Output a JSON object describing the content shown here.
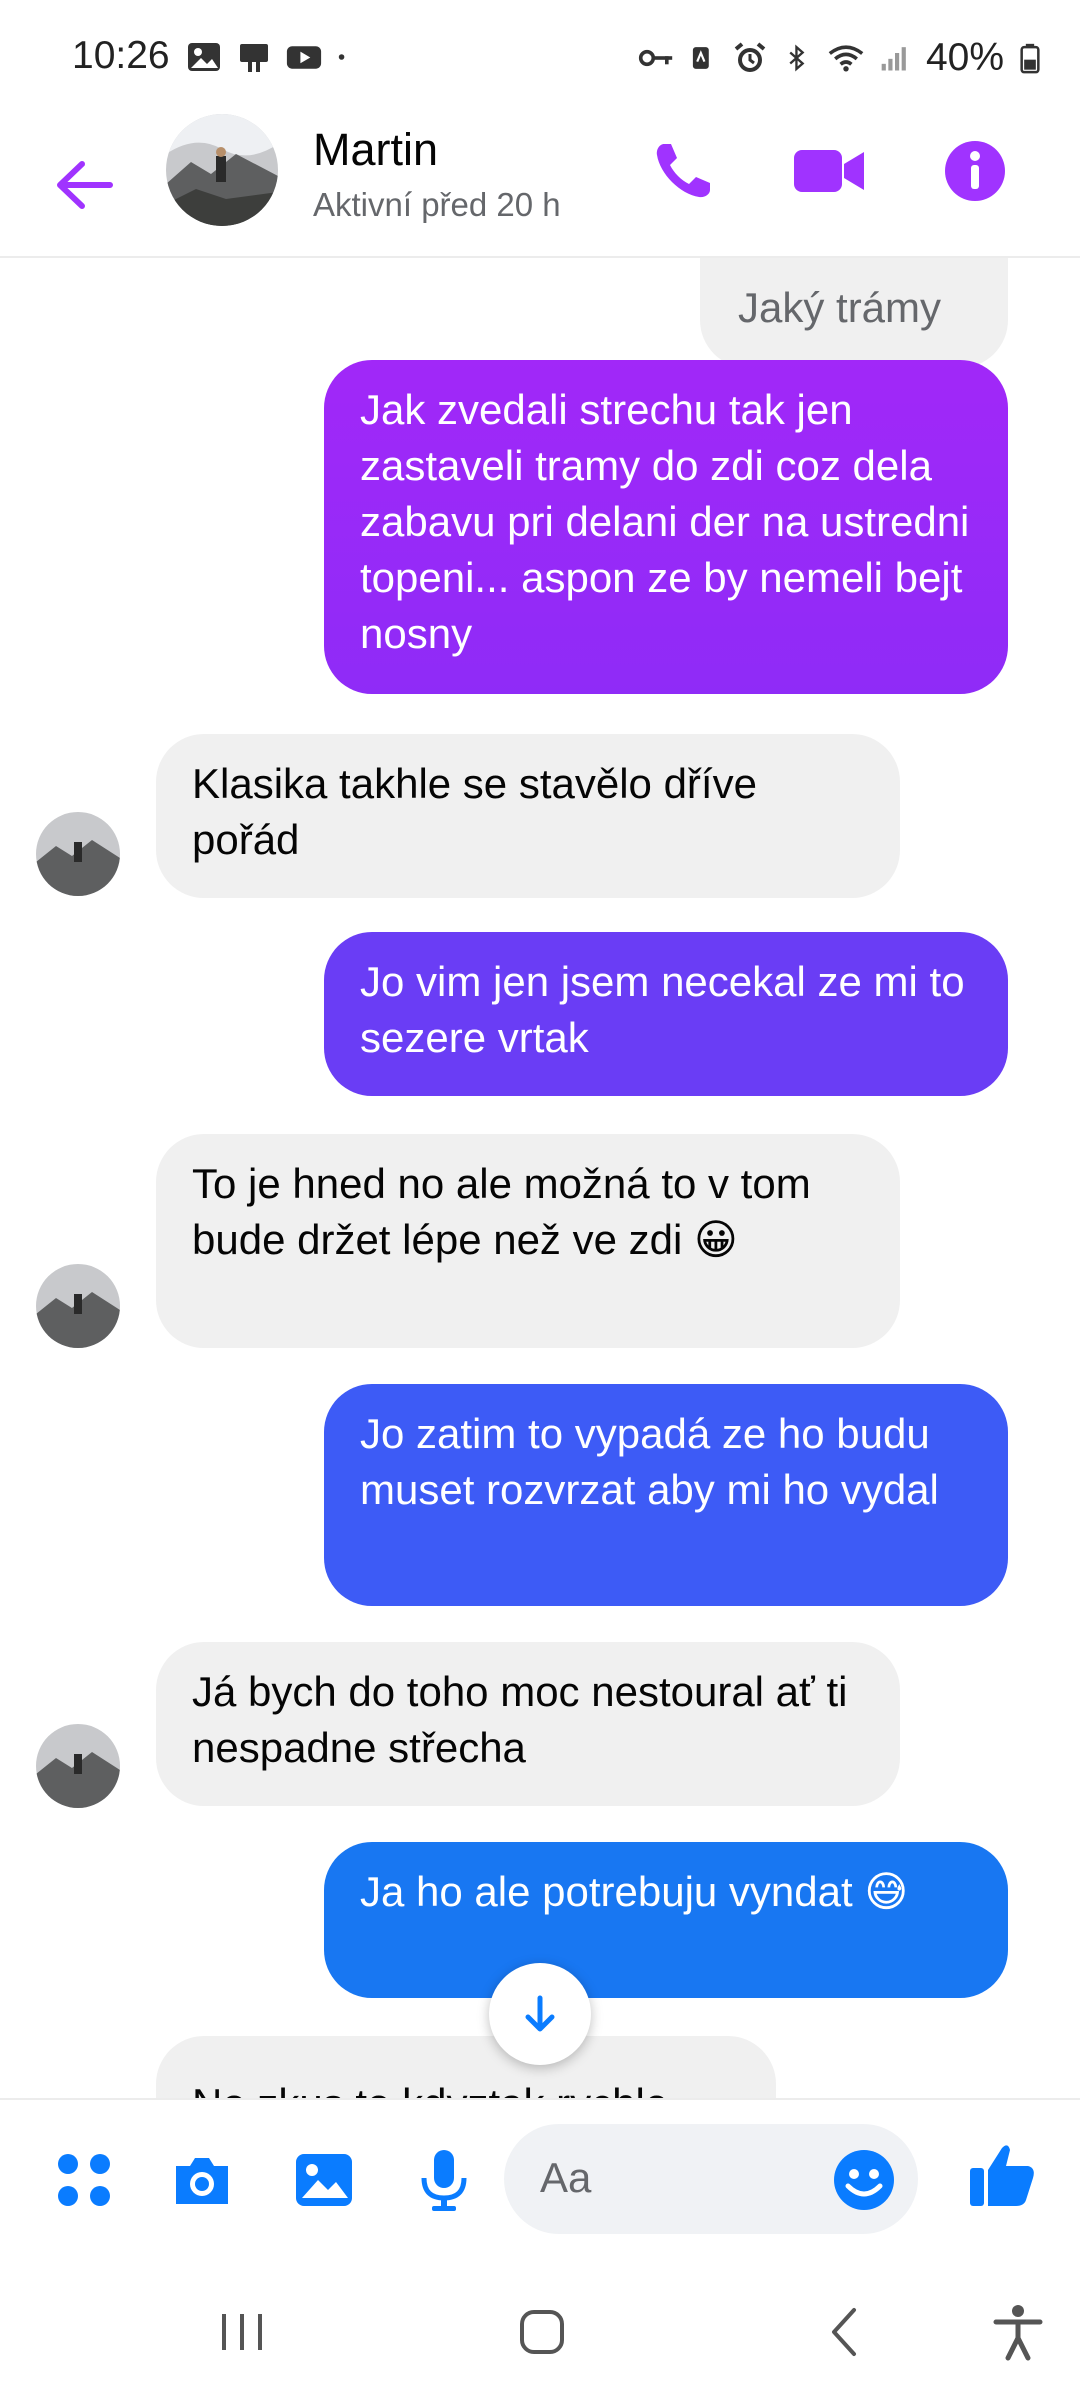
{
  "status_bar": {
    "time": "10:26",
    "battery_pct": "40%",
    "left_icons": [
      "gallery-icon",
      "cast-icon",
      "youtube-icon",
      "dot-icon"
    ],
    "right_icons": [
      "key-icon",
      "nfc-icon",
      "alarm-icon",
      "bluetooth-icon",
      "wifi-icon",
      "signal-icon",
      "battery-icon"
    ]
  },
  "header": {
    "contact_name": "Martin",
    "contact_status": "Aktivní před 20 h",
    "accent": "#a033ff"
  },
  "messages": [
    {
      "dir": "in",
      "text": "Jaký trámy"
    },
    {
      "dir": "out",
      "text": "Jak zvedali strechu tak jen zastaveli tramy do zdi coz dela zabavu pri delani der na ustredni topeni... aspon ze by nemeli bejt nosny",
      "color": "#9a1cf5"
    },
    {
      "dir": "in",
      "text": "Klasika takhle se stavělo dříve pořád"
    },
    {
      "dir": "out",
      "text": "Jo vim jen jsem necekal ze mi to sezere vrtak",
      "color": "#6a3df5"
    },
    {
      "dir": "in",
      "text": "To je hned no ale možná to v tom bude držet lépe než ve zdi 😀"
    },
    {
      "dir": "out",
      "text": "Jo zatim to vypadá ze ho budu muset rozvrzat aby mi ho vydal",
      "color": "#3d5bf6"
    },
    {
      "dir": "in",
      "text": "Já bych do toho moc nestoural ať ti nespadne střecha"
    },
    {
      "dir": "out",
      "text": "Ja ho ale potrebuju vyndat 😅",
      "color": "#1877f2"
    },
    {
      "dir": "in",
      "text": "No zkus to kdyztak rychle"
    }
  ],
  "composer": {
    "placeholder": "Aa",
    "accent": "#0a7cff"
  }
}
